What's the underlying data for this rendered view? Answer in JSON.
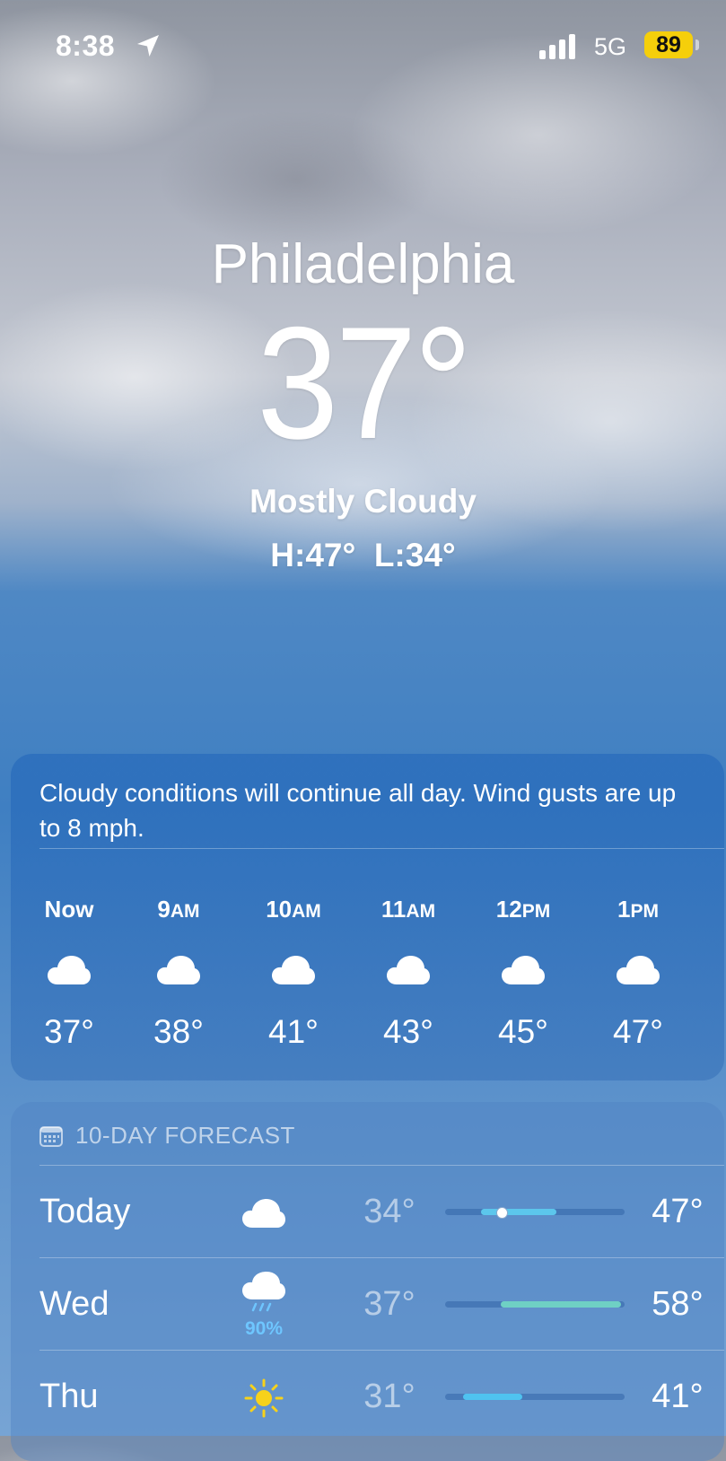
{
  "status_bar": {
    "time": "8:38",
    "network": "5G",
    "battery": "89",
    "battery_color": "#f5cf0b"
  },
  "current": {
    "city": "Philadelphia",
    "temperature": "37°",
    "condition": "Mostly Cloudy",
    "high_low": "H:47°  L:34°"
  },
  "hourly": {
    "summary": "Cloudy conditions will continue all day. Wind gusts are up to 8 mph.",
    "hours": [
      {
        "time": "Now",
        "suffix": "",
        "icon": "cloud-icon",
        "temp": "37°"
      },
      {
        "time": "9",
        "suffix": "AM",
        "icon": "cloud-icon",
        "temp": "38°"
      },
      {
        "time": "10",
        "suffix": "AM",
        "icon": "cloud-icon",
        "temp": "41°"
      },
      {
        "time": "11",
        "suffix": "AM",
        "icon": "cloud-icon",
        "temp": "43°"
      },
      {
        "time": "12",
        "suffix": "PM",
        "icon": "cloud-icon",
        "temp": "45°"
      },
      {
        "time": "1",
        "suffix": "PM",
        "icon": "cloud-icon",
        "temp": "47°"
      }
    ]
  },
  "forecast": {
    "title": "10-DAY FORECAST",
    "icon": "calendar-icon",
    "days": [
      {
        "day": "Today",
        "icon": "cloud-icon",
        "precip": "",
        "low": "34°",
        "high": "47°",
        "range_start": 0.2,
        "range_end": 0.62,
        "current": 0.31,
        "bar_color": "#5cc6ec"
      },
      {
        "day": "Wed",
        "icon": "cloud-rain-icon",
        "precip": "90%",
        "low": "37°",
        "high": "58°",
        "range_start": 0.31,
        "range_end": 0.98,
        "current": null,
        "bar_color": "#6fd0c4"
      },
      {
        "day": "Thu",
        "icon": "sun-icon",
        "precip": "",
        "low": "31°",
        "high": "41°",
        "range_start": 0.1,
        "range_end": 0.43,
        "current": null,
        "bar_color": "#4fc3f0"
      }
    ]
  }
}
